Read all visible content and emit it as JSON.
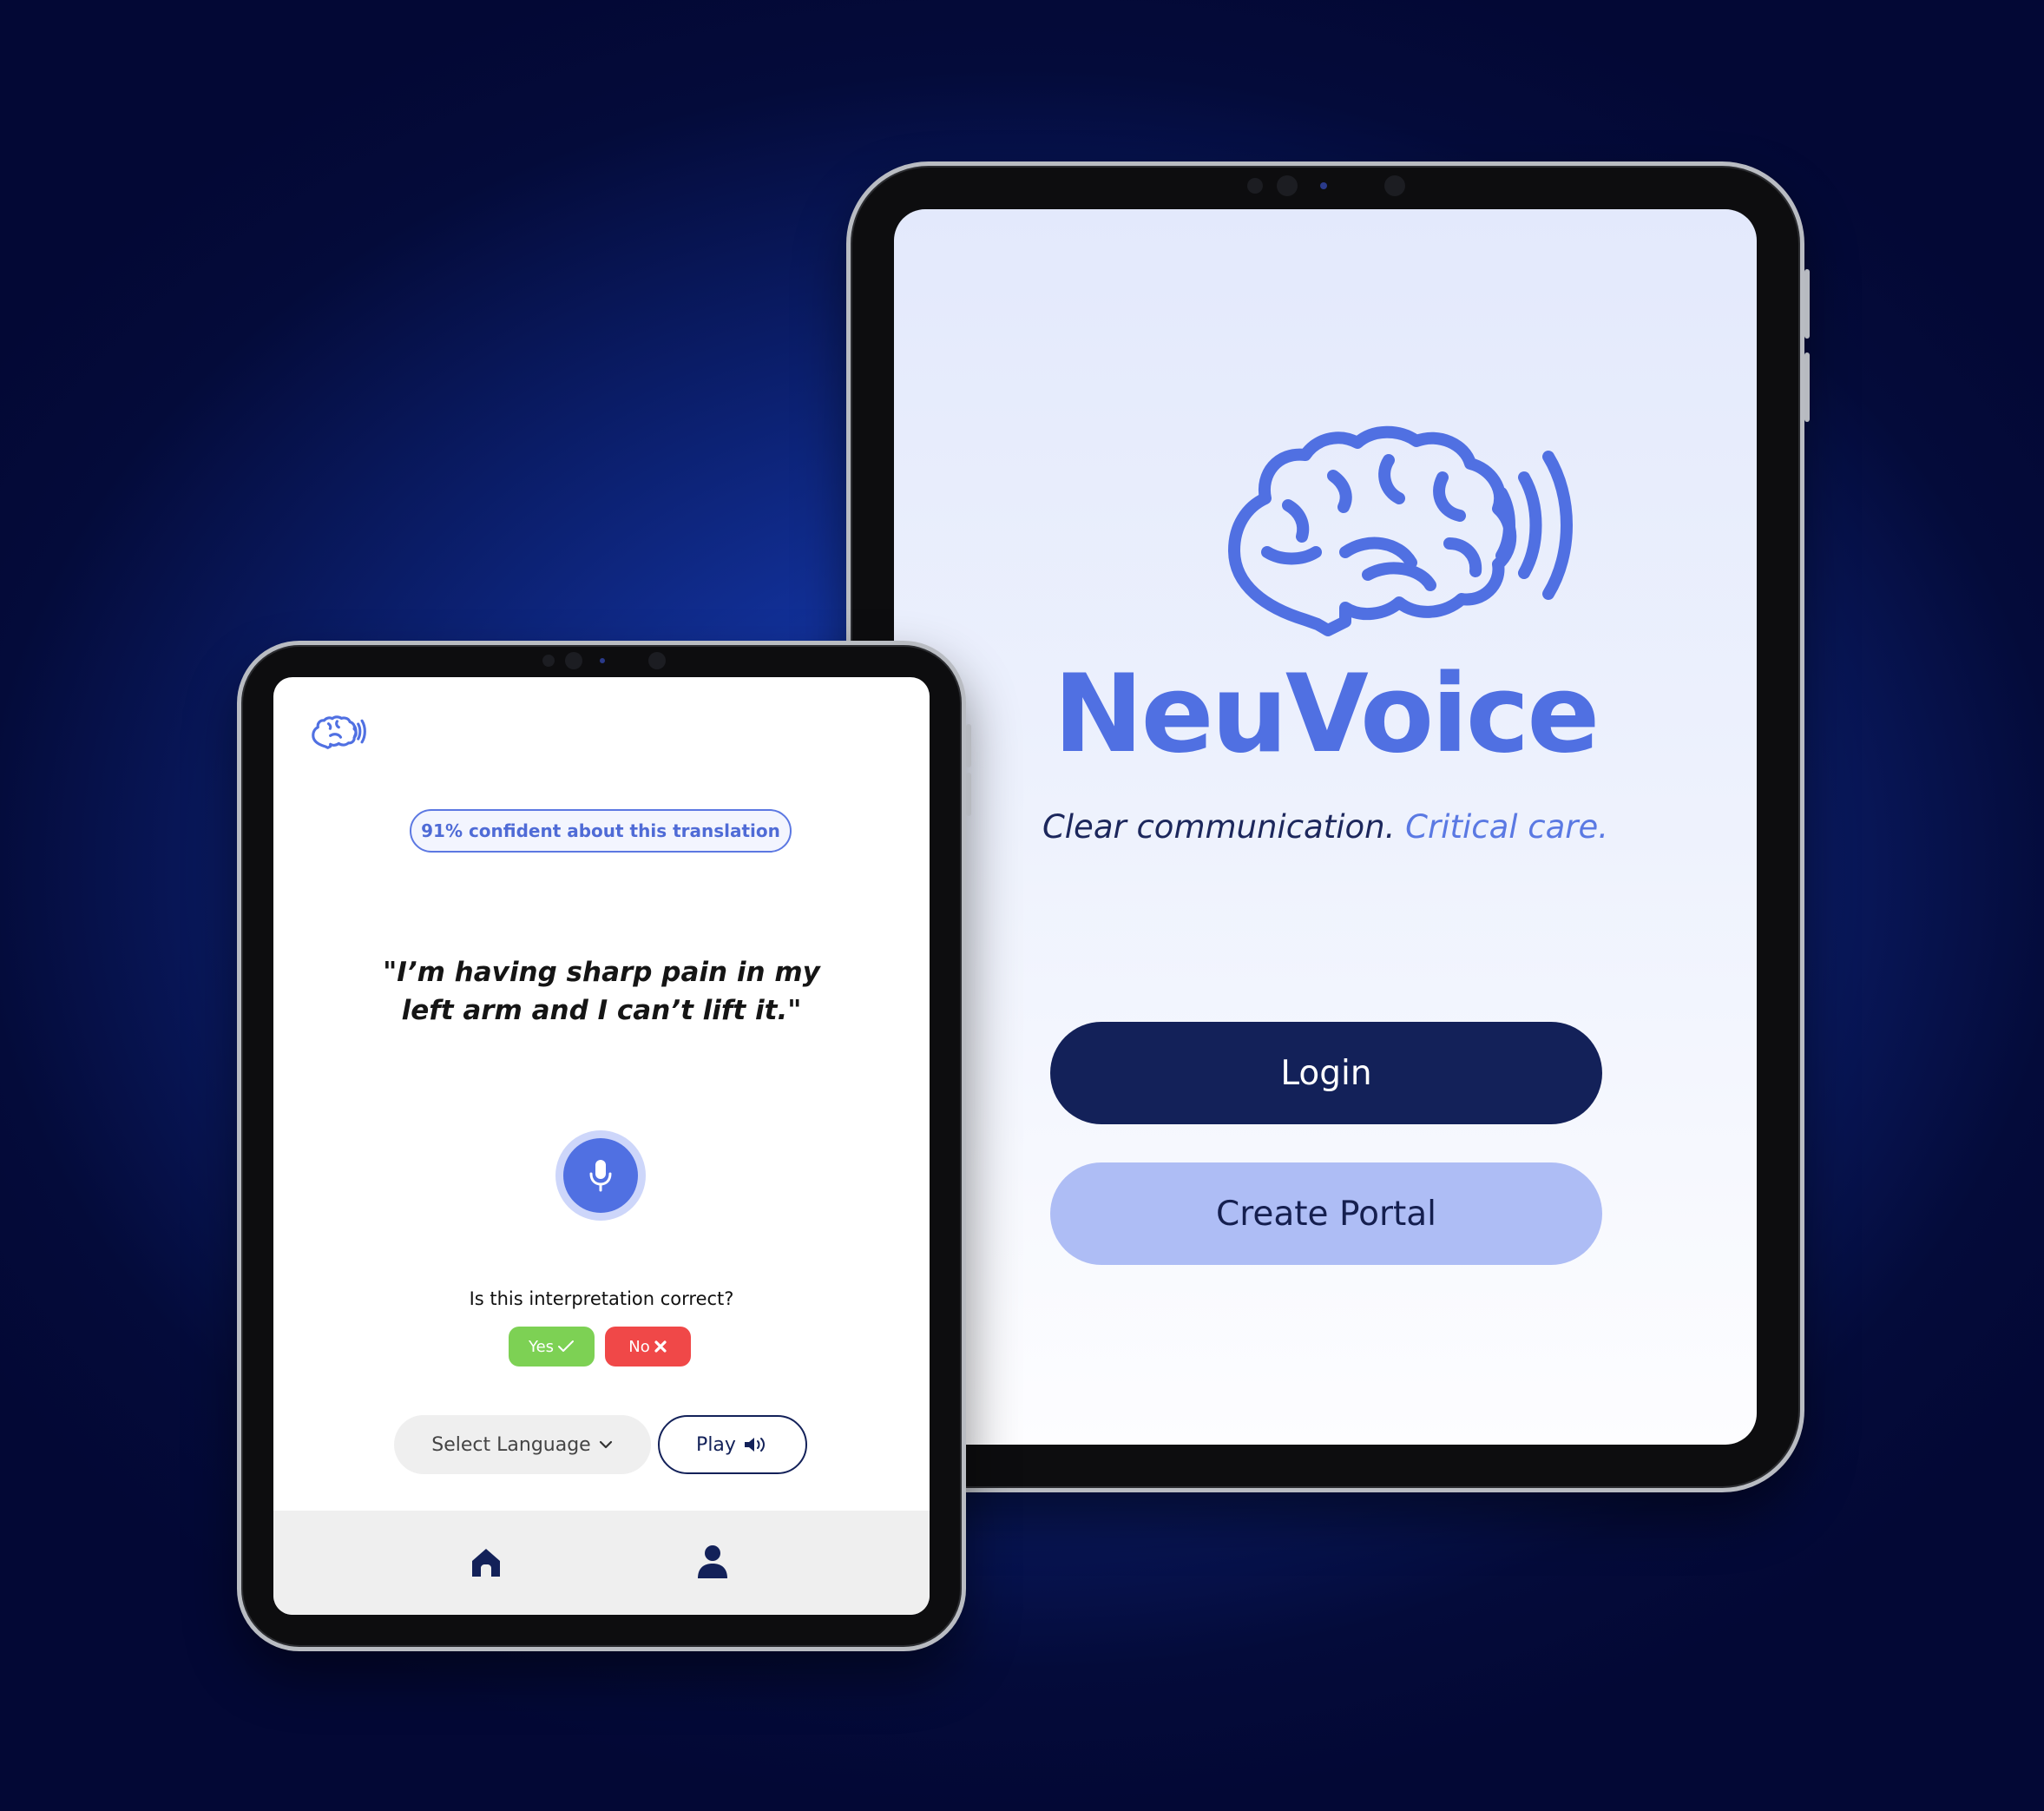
{
  "colors": {
    "brand_blue": "#5070e2",
    "navy": "#132159",
    "light_button": "#aebdf5",
    "yes_green": "#7dd154",
    "no_red": "#f04848"
  },
  "icons": [
    "brain-voice-logo-icon",
    "microphone-icon",
    "check-icon",
    "close-icon",
    "chevron-down-icon",
    "speaker-icon",
    "home-icon",
    "user-icon"
  ],
  "welcome_screen": {
    "app_name": "NeuVoice",
    "tagline_part1": "Clear communication.",
    "tagline_part2": "Critical care.",
    "login_label": "Login",
    "create_portal_label": "Create Portal"
  },
  "translation_screen": {
    "confidence_text": "91% confident about this translation",
    "quote": "\"I’m having sharp pain in my left arm and I can’t lift it.\"",
    "question": "Is this interpretation correct?",
    "yes_label": "Yes",
    "no_label": "No",
    "language_select_label": "Select Language",
    "play_label": "Play"
  }
}
